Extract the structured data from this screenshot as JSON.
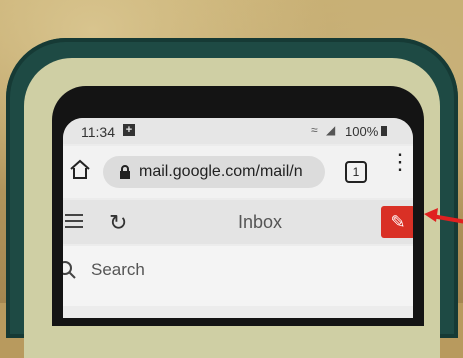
{
  "statusbar": {
    "time": "11:34",
    "notification_glyph": "+",
    "battery_text": "100%",
    "icons": [
      "wifi-icon",
      "signal-icon",
      "battery-icon"
    ]
  },
  "browser": {
    "url": "mail.google.com/mail/n",
    "tab_count": "1",
    "icons": [
      "home-icon",
      "lock-icon",
      "tab-counter",
      "menu-icon"
    ]
  },
  "gmail": {
    "title": "Inbox",
    "search_placeholder": "Search",
    "icons": [
      "hamburger-icon",
      "refresh-icon",
      "compose-pencil-icon",
      "search-icon"
    ],
    "compose_color": "#d93025"
  },
  "annotation": {
    "arrow_color": "#e02020"
  }
}
